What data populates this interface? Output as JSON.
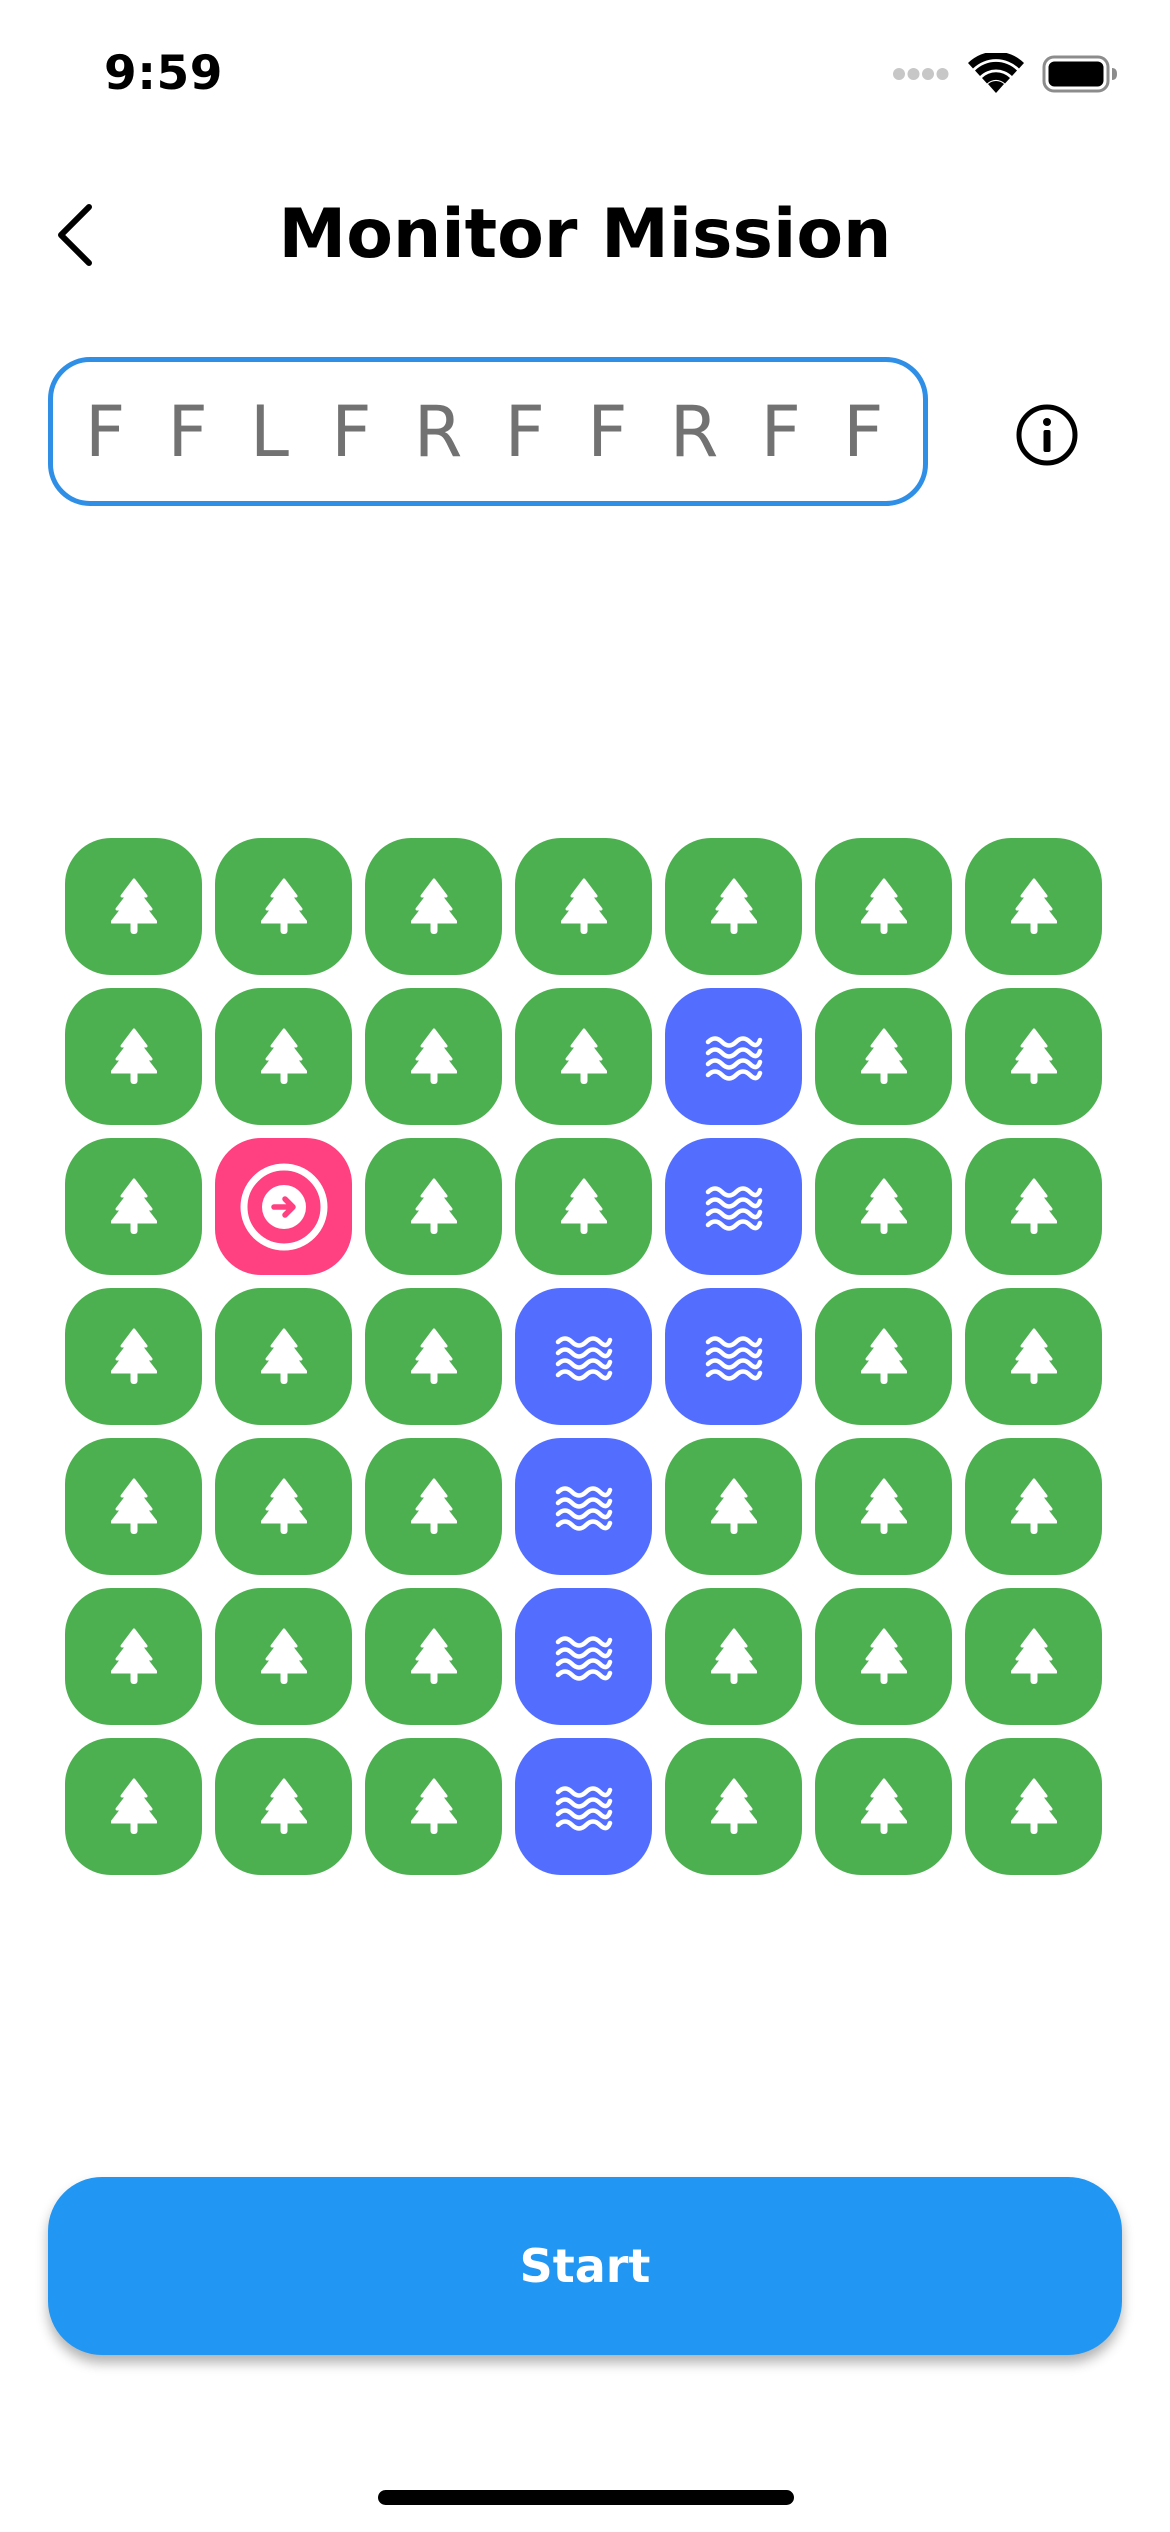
{
  "status_bar": {
    "time": "9:59"
  },
  "nav": {
    "title": "Monitor Mission"
  },
  "command_input": {
    "value": "F F L F R F F R F F"
  },
  "grid": {
    "rows": [
      [
        "forest",
        "forest",
        "forest",
        "forest",
        "forest",
        "forest",
        "forest"
      ],
      [
        "forest",
        "forest",
        "forest",
        "forest",
        "water",
        "forest",
        "forest"
      ],
      [
        "forest",
        "rover",
        "forest",
        "forest",
        "water",
        "forest",
        "forest"
      ],
      [
        "forest",
        "forest",
        "forest",
        "water",
        "water",
        "forest",
        "forest"
      ],
      [
        "forest",
        "forest",
        "forest",
        "water",
        "forest",
        "forest",
        "forest"
      ],
      [
        "forest",
        "forest",
        "forest",
        "water",
        "forest",
        "forest",
        "forest"
      ],
      [
        "forest",
        "forest",
        "forest",
        "water",
        "forest",
        "forest",
        "forest"
      ]
    ],
    "icons": {
      "forest": "tree-icon",
      "water": "waves-icon",
      "rover": "arrow-right-circle-icon"
    },
    "colors": {
      "forest": "#4CAF50",
      "water": "#536DFE",
      "rover": "#FF4081"
    }
  },
  "actions": {
    "start_label": "Start"
  },
  "colors": {
    "accent": "#2196F3",
    "input_border": "#2F8FE6"
  }
}
